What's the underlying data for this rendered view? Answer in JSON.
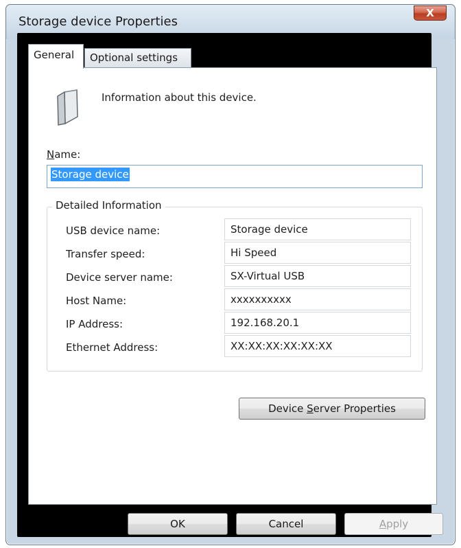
{
  "window": {
    "title": "Storage device Properties",
    "close_label": "X"
  },
  "tabs": [
    {
      "label": "General",
      "active": true
    },
    {
      "label": "Optional settings",
      "active": false
    }
  ],
  "general": {
    "info_text": "Information about this device.",
    "name_label": "Name:",
    "name_label_accel": "N",
    "name_label_rest": "ame:",
    "name_value": "Storage device",
    "group_title": "Detailed Information",
    "rows": [
      {
        "label": "USB device name:",
        "value": "Storage device"
      },
      {
        "label": "Transfer speed:",
        "value": "Hi Speed"
      },
      {
        "label": "Device server name:",
        "value": "SX-Virtual USB"
      },
      {
        "label": "Host Name:",
        "value": "xxxxxxxxxx"
      },
      {
        "label": "IP Address:",
        "value": "192.168.20.1"
      },
      {
        "label": "Ethernet Address:",
        "value": "XX:XX:XX:XX:XX:XX"
      }
    ],
    "device_server_button": "Device Server Properties",
    "device_server_button_pre": "Device ",
    "device_server_button_accel": "S",
    "device_server_button_post": "erver Properties"
  },
  "footer": {
    "ok": "OK",
    "cancel": "Cancel",
    "apply": "Apply",
    "apply_accel": "A",
    "apply_rest": "pply",
    "apply_enabled": false
  },
  "icons": {
    "close": "close-icon",
    "device": "storage-device-icon"
  }
}
